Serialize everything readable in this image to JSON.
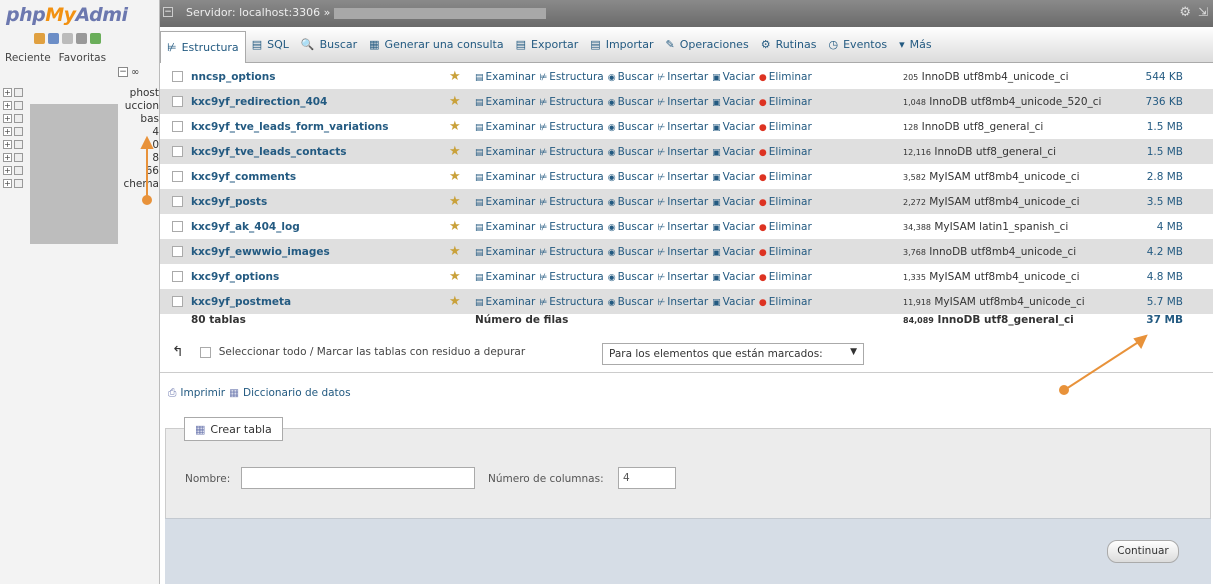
{
  "nav": {
    "logo_php": "php",
    "logo_my": "My",
    "logo_admin": "Admi",
    "links": [
      "Reciente",
      "Favoritas"
    ],
    "tree": [
      {
        "name": "phost"
      },
      {
        "name": "uccion"
      },
      {
        "name": "bas"
      },
      {
        "name": "4"
      },
      {
        "name": "0"
      },
      {
        "name": "8"
      },
      {
        "name": "66"
      },
      {
        "name": "chema"
      }
    ]
  },
  "topbar": {
    "breadcrumb": "Servidor: localhost:3306 »"
  },
  "tabs": [
    {
      "label": "Estructura",
      "icon": "structure-icon",
      "glyph": "⊭",
      "active": true
    },
    {
      "label": "SQL",
      "icon": "sql-icon",
      "glyph": "▤"
    },
    {
      "label": "Buscar",
      "icon": "search-icon",
      "glyph": "🔍"
    },
    {
      "label": "Generar una consulta",
      "icon": "query-icon",
      "glyph": "▦"
    },
    {
      "label": "Exportar",
      "icon": "export-icon",
      "glyph": "▤"
    },
    {
      "label": "Importar",
      "icon": "import-icon",
      "glyph": "▤"
    },
    {
      "label": "Operaciones",
      "icon": "wrench-icon",
      "glyph": "✎"
    },
    {
      "label": "Rutinas",
      "icon": "routines-icon",
      "glyph": "⚙"
    },
    {
      "label": "Eventos",
      "icon": "clock-icon",
      "glyph": "◷"
    },
    {
      "label": "Más",
      "icon": "more-icon",
      "glyph": "▾"
    }
  ],
  "actions": {
    "browse": "Examinar",
    "structure": "Estructura",
    "search": "Buscar",
    "insert": "Insertar",
    "empty": "Vaciar",
    "drop": "Eliminar"
  },
  "tables": [
    {
      "name": "nncsp_options",
      "rows": "205",
      "engine": "InnoDB",
      "collation": "utf8mb4_unicode_ci",
      "size": "544 KB"
    },
    {
      "name": "kxc9yf_redirection_404",
      "rows": "1,048",
      "engine": "InnoDB",
      "collation": "utf8mb4_unicode_520_ci",
      "size": "736 KB"
    },
    {
      "name": "kxc9yf_tve_leads_form_variations",
      "rows": "128",
      "engine": "InnoDB",
      "collation": "utf8_general_ci",
      "size": "1.5 MB"
    },
    {
      "name": "kxc9yf_tve_leads_contacts",
      "rows": "12,116",
      "engine": "InnoDB",
      "collation": "utf8_general_ci",
      "size": "1.5 MB"
    },
    {
      "name": "kxc9yf_comments",
      "rows": "3,582",
      "engine": "MyISAM",
      "collation": "utf8mb4_unicode_ci",
      "size": "2.8 MB"
    },
    {
      "name": "kxc9yf_posts",
      "rows": "2,272",
      "engine": "MyISAM",
      "collation": "utf8mb4_unicode_ci",
      "size": "3.5 MB"
    },
    {
      "name": "kxc9yf_ak_404_log",
      "rows": "34,388",
      "engine": "MyISAM",
      "collation": "latin1_spanish_ci",
      "size": "4 MB"
    },
    {
      "name": "kxc9yf_ewwwio_images",
      "rows": "3,768",
      "engine": "InnoDB",
      "collation": "utf8mb4_unicode_ci",
      "size": "4.2 MB"
    },
    {
      "name": "kxc9yf_options",
      "rows": "1,335",
      "engine": "MyISAM",
      "collation": "utf8mb4_unicode_ci",
      "size": "4.8 MB"
    },
    {
      "name": "kxc9yf_postmeta",
      "rows": "11,918",
      "engine": "MyISAM",
      "collation": "utf8mb4_unicode_ci",
      "size": "5.7 MB"
    }
  ],
  "totals": {
    "tables": "80 tablas",
    "rows_label": "Número de filas",
    "rows": "84,089",
    "engine": "InnoDB",
    "collation": "utf8_general_ci",
    "size": "37 MB"
  },
  "bulk": {
    "select_all": "Seleccionar todo / Marcar las tablas con residuo a depurar",
    "with_selected": "Para los elementos que están marcados:"
  },
  "links": {
    "print": "Imprimir",
    "dictionary": "Diccionario de datos"
  },
  "create": {
    "legend": "Crear tabla",
    "name_label": "Nombre:",
    "name_value": "",
    "cols_label": "Número de columnas:",
    "cols_value": "4",
    "submit": "Continuar"
  },
  "colors": {
    "link": "#235a81",
    "annotation": "#e8923a"
  }
}
